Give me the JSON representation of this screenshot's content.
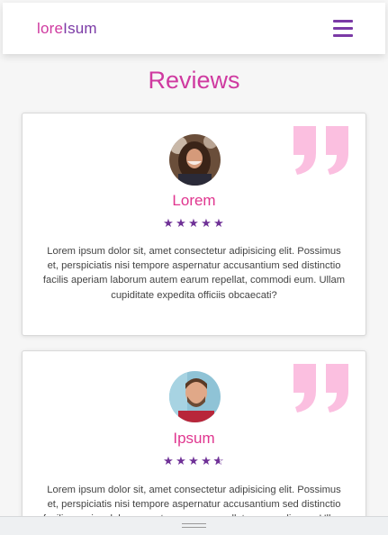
{
  "navbar": {
    "brand_part1": "lore",
    "brand_part2": "Isum",
    "menu_icon": "hamburger-menu-icon"
  },
  "section": {
    "title": "Reviews"
  },
  "reviews": [
    {
      "name": "Lorem",
      "rating": 5,
      "rating_max": 5,
      "text": "Lorem ipsum dolor sit, amet consectetur adipisicing elit. Possimus et, perspiciatis nisi tempore aspernatur accusantium sed distinctio facilis aperiam laborum autem earum repellat, commodi eum. Ullam cupiditate expedita officiis obcaecati?"
    },
    {
      "name": "Ipsum",
      "rating": 4.5,
      "rating_max": 5,
      "text": "Lorem ipsum dolor sit, amet consectetur adipisicing elit. Possimus et, perspiciatis nisi tempore aspernatur accusantium sed distinctio facilis aperiam laborum autem earum repellat, commodi eum. Ullam cupiditate expedita officiis obcaecati?"
    }
  ],
  "colors": {
    "accent_pink": "#cf3aa0",
    "accent_purple": "#7b3aa6",
    "quote_pink": "#fbbfe0"
  }
}
